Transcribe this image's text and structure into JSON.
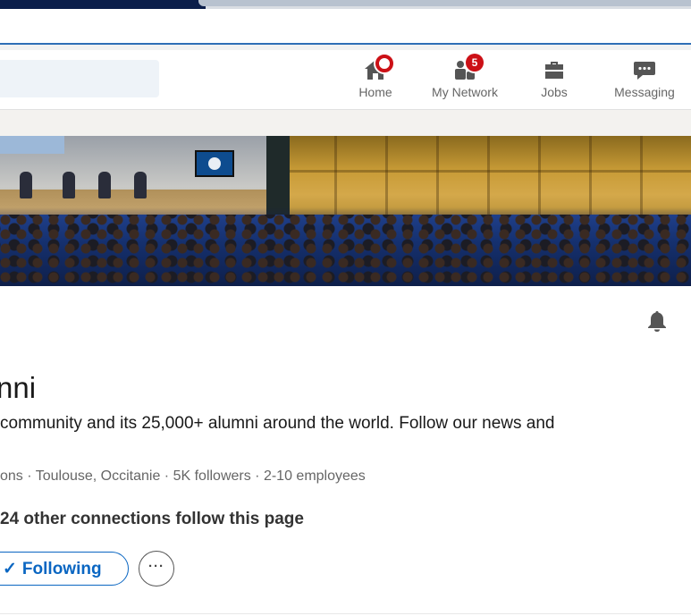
{
  "nav": {
    "search": {
      "placeholder": ""
    },
    "items": [
      {
        "label": "Home",
        "icon": "home-icon",
        "badge": "",
        "badge_style": "ring"
      },
      {
        "label": "My Network",
        "icon": "people-icon",
        "badge": "5",
        "badge_style": "count"
      },
      {
        "label": "Jobs",
        "icon": "briefcase-icon",
        "badge": "",
        "badge_style": "none"
      },
      {
        "label": "Messaging",
        "icon": "chat-bubble-icon",
        "badge": "",
        "badge_style": "none"
      }
    ]
  },
  "profile": {
    "name": "nni",
    "tagline": "community and its 25,000+ alumni around the world. Follow our news and",
    "meta": "ons · Toulouse, Occitanie · 5K followers · 2-10 employees",
    "connections": "24 other connections follow this page",
    "follow_label": "Following",
    "follow_check": "✓",
    "more_label": "···"
  },
  "colors": {
    "accent": "#0a66c2",
    "badge": "#cc1016",
    "nav_icon": "#555555",
    "muted_text": "#666666"
  }
}
